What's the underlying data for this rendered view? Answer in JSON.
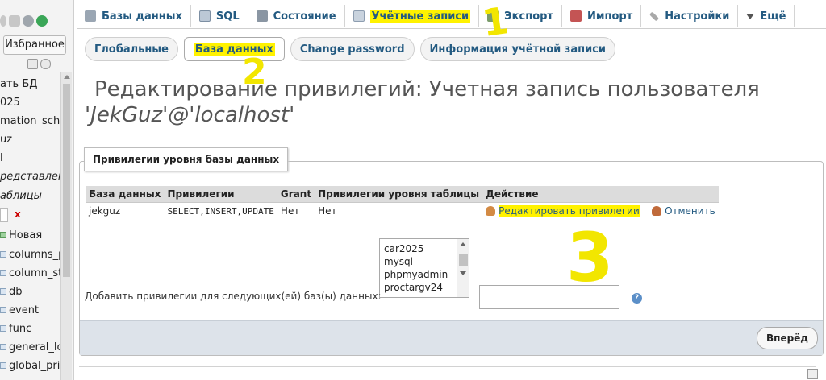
{
  "sidebar": {
    "favorites_label": "Избранное",
    "items": [
      {
        "label": "ать БД"
      },
      {
        "label": "025"
      },
      {
        "label": "mation_schem"
      },
      {
        "label": "uz"
      },
      {
        "label": "l"
      },
      {
        "label": "редставлени",
        "italic": true
      },
      {
        "label": "аблицы",
        "italic": true
      },
      {
        "label": "Новая",
        "icon": "new-table-icon"
      },
      {
        "label": "columns_p",
        "icon": "table-icon"
      },
      {
        "label": "column_sta",
        "icon": "table-icon"
      },
      {
        "label": "db",
        "icon": "table-icon"
      },
      {
        "label": "event",
        "icon": "table-icon"
      },
      {
        "label": "func",
        "icon": "table-icon"
      },
      {
        "label": "general_log",
        "icon": "table-icon"
      },
      {
        "label": "global_priv",
        "icon": "table-icon"
      }
    ],
    "filter_clear": "x"
  },
  "tabs": [
    {
      "label": "Базы данных",
      "icon": "databases-icon"
    },
    {
      "label": "SQL",
      "icon": "sql-icon"
    },
    {
      "label": "Состояние",
      "icon": "status-icon"
    },
    {
      "label": "Учётные записи",
      "icon": "user-accounts-icon",
      "active": true
    },
    {
      "label": "Экспорт",
      "icon": "export-icon"
    },
    {
      "label": "Импорт",
      "icon": "import-icon"
    },
    {
      "label": "Настройки",
      "icon": "settings-icon"
    },
    {
      "label": "Ещё",
      "icon": "chevron-down-icon"
    }
  ],
  "subtabs": [
    {
      "label": "Глобальные"
    },
    {
      "label": "База данных",
      "active": true
    },
    {
      "label": "Change password"
    },
    {
      "label": "Информация учётной записи"
    }
  ],
  "heading": {
    "line1": "Редактирование привилегий: Учетная запись пользователя",
    "line2": "'JekGuz'@'localhost'"
  },
  "section_legend": "Привилегии уровня базы данных",
  "table": {
    "headers": [
      "База данных",
      "Привилегии",
      "Grant",
      "Привилегии уровня таблицы",
      "Действие"
    ],
    "rows": [
      {
        "database": "jekguz",
        "privileges": "SELECT,INSERT,UPDATE",
        "grant": "Нет",
        "table_privs": "Нет",
        "edit_action": "Редактировать привилегии",
        "revoke_action": "Отменить"
      }
    ]
  },
  "add_privileges": {
    "label": "Добавить привилегии для следующих(ей) баз(ы) данных:",
    "databases": [
      "car2025",
      "mysql",
      "phpmyadmin",
      "proctargv24"
    ],
    "input_value": ""
  },
  "go_button": "Вперёд",
  "annotations": [
    "1",
    "2",
    "3"
  ],
  "colors": {
    "link": "#235a81",
    "highlight": "#fff200",
    "annotation": "#f2e600",
    "footer_bar": "#dde3ea"
  }
}
